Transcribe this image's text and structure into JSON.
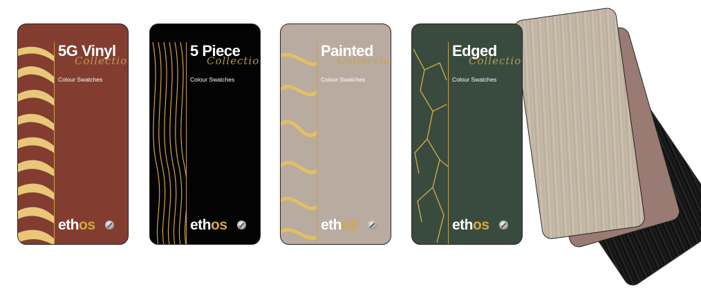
{
  "cards": [
    {
      "title": "5G Vinyl",
      "script": "Collection",
      "subtitle": "Colour Swatches",
      "logo_main": "eth",
      "logo_accent": "os",
      "background": "#823d30",
      "accent": "#e8c878"
    },
    {
      "title": "5 Piece",
      "script": "Collection",
      "subtitle": "Colour Swatches",
      "logo_main": "eth",
      "logo_accent": "os",
      "background": "#030303",
      "accent": "#d4a645"
    },
    {
      "title": "Painted",
      "script": "Collection",
      "subtitle": "Colour Swatches",
      "logo_main": "eth",
      "logo_accent": "os",
      "background": "#b9ab9f",
      "accent": "#d8b45c"
    },
    {
      "title": "Edged",
      "script": "Collection",
      "subtitle": "Colour Swatches",
      "logo_main": "eth",
      "logo_accent": "os",
      "background": "#384b3e",
      "accent": "#d4a645"
    }
  ],
  "fan_swatches": [
    {
      "name": "light-oak-swatch",
      "color": "#c5b9a8"
    },
    {
      "name": "dusty-pink-swatch",
      "color": "#9a7b74"
    },
    {
      "name": "black-wood-swatch",
      "color": "#151515"
    }
  ]
}
